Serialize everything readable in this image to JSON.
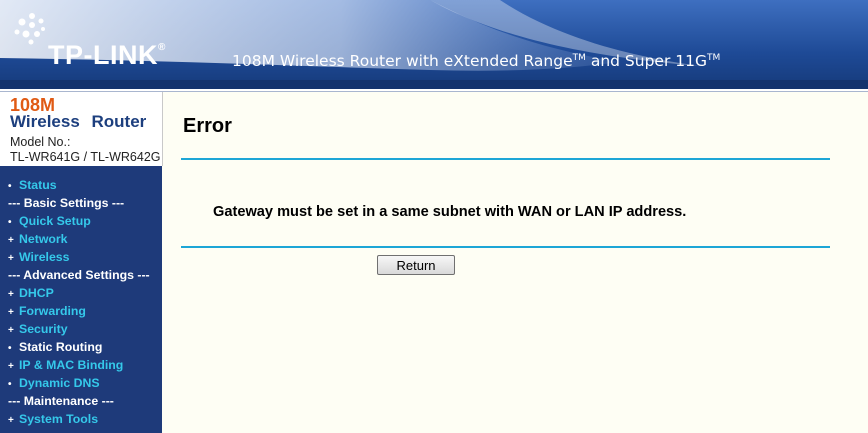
{
  "header": {
    "logo_text": "TP-LINK",
    "logo_mark": "®",
    "tagline_part1": "108M Wireless Router with eXtended Range",
    "tagline_tm1": "TM",
    "tagline_part2": " and Super 11G",
    "tagline_tm2": "TM"
  },
  "product": {
    "size": "108M",
    "name": "Wireless Router",
    "model_label": "Model No.:",
    "model": "TL-WR641G / TL-WR642G"
  },
  "menu": {
    "status": "Status",
    "basic_heading": "--- Basic Settings ---",
    "quick_setup": "Quick Setup",
    "network": "Network",
    "wireless": "Wireless",
    "advanced_heading": "--- Advanced Settings ---",
    "dhcp": "DHCP",
    "forwarding": "Forwarding",
    "security": "Security",
    "static_routing": "Static Routing",
    "ip_mac_binding": "IP & MAC Binding",
    "dynamic_dns": "Dynamic DNS",
    "maintenance_heading": "--- Maintenance ---",
    "system_tools": "System Tools",
    "bullet_dot": "•",
    "bullet_plus": "+"
  },
  "main": {
    "title": "Error",
    "message": "Gateway must be set in a same subnet with WAN or LAN IP address.",
    "return_label": "Return"
  },
  "colors": {
    "header_bg": "#1b3d7c",
    "menu_bg": "#1e3a7a",
    "menu_link": "#35c9ea",
    "rule": "#1da6d6",
    "content_bg": "#fefef4",
    "product_accent": "#e05a14"
  }
}
